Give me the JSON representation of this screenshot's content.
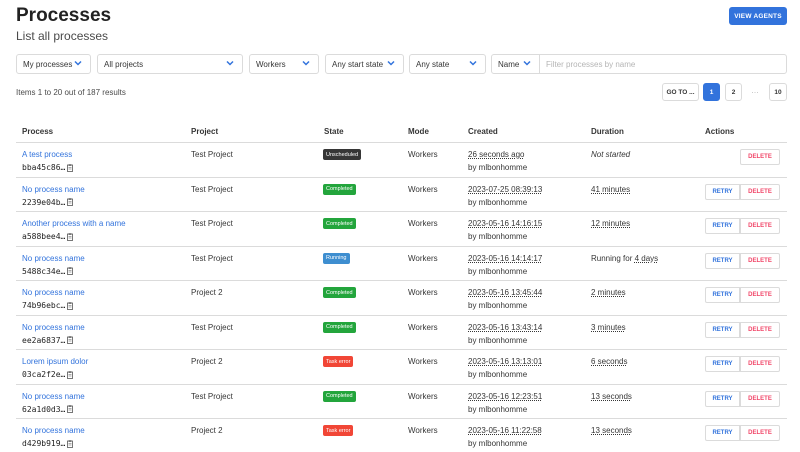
{
  "header": {
    "title": "Processes",
    "subtitle": "List all processes",
    "view_agents_label": "VIEW AGENTS"
  },
  "filters": {
    "my_processes": "My processes",
    "all_projects": "All projects",
    "mode": "Workers",
    "start_state": "Any start state",
    "state": "Any state",
    "name_field": "Name",
    "name_placeholder": "Filter processes by name"
  },
  "results": {
    "summary": "Items 1 to 20 out of 187 results"
  },
  "pagination": {
    "goto_label": "GO TO ...",
    "pages": [
      "1",
      "2",
      "10"
    ],
    "ellipsis": "…",
    "current": "1"
  },
  "table": {
    "columns": [
      "Process",
      "Project",
      "State",
      "Mode",
      "Created",
      "Duration",
      "Actions"
    ],
    "retry_label": "RETRY",
    "delete_label": "DELETE",
    "rows": [
      {
        "name": "A test process",
        "id": "bba45c86…",
        "project": "Test Project",
        "state": "Unscheduled",
        "mode": "Workers",
        "created": "26 seconds ago",
        "created_by": "by mlbonhomme",
        "duration": "Not started"
      },
      {
        "name": "No process name",
        "id": "2239e04b…",
        "project": "Test Project",
        "state": "Completed",
        "mode": "Workers",
        "created": "2023-07-25 08:39:13",
        "created_by": "by mlbonhomme",
        "duration": "41 minutes"
      },
      {
        "name": "Another process with a name",
        "id": "a588bee4…",
        "project": "Test Project",
        "state": "Completed",
        "mode": "Workers",
        "created": "2023-05-16 14:16:15",
        "created_by": "by mlbonhomme",
        "duration": "12 minutes"
      },
      {
        "name": "No process name",
        "id": "5488c34e…",
        "project": "Test Project",
        "state": "Running",
        "mode": "Workers",
        "created": "2023-05-16 14:14:17",
        "created_by": "by mlbonhomme",
        "duration_prefix": "Running for ",
        "duration": "4 days"
      },
      {
        "name": "No process name",
        "id": "74b96ebc…",
        "project": "Project 2",
        "state": "Completed",
        "mode": "Workers",
        "created": "2023-05-16 13:45:44",
        "created_by": "by mlbonhomme",
        "duration": "2 minutes"
      },
      {
        "name": "No process name",
        "id": "ee2a6837…",
        "project": "Test Project",
        "state": "Completed",
        "mode": "Workers",
        "created": "2023-05-16 13:43:14",
        "created_by": "by mlbonhomme",
        "duration": "3 minutes"
      },
      {
        "name": "Lorem ipsum dolor",
        "id": "03ca2f2e…",
        "project": "Project 2",
        "state": "Task error",
        "mode": "Workers",
        "created": "2023-05-16 13:13:01",
        "created_by": "by mlbonhomme",
        "duration": "6 seconds"
      },
      {
        "name": "No process name",
        "id": "62a1d0d3…",
        "project": "Test Project",
        "state": "Completed",
        "mode": "Workers",
        "created": "2023-05-16 12:23:51",
        "created_by": "by mlbonhomme",
        "duration": "13 seconds"
      },
      {
        "name": "No process name",
        "id": "d429b919…",
        "project": "Project 2",
        "state": "Task error",
        "mode": "Workers",
        "created": "2023-05-16 11:22:58",
        "created_by": "by mlbonhomme",
        "duration": "13 seconds"
      }
    ]
  },
  "colors": {
    "primary": "#3273dc",
    "link": "#3273dc",
    "danger": "#f14668",
    "state_unscheduled": "#363636",
    "state_completed": "#23a53c",
    "state_running": "#3e8ed0",
    "state_task_error": "#f14636"
  },
  "icons": {
    "dropdown": "chevron-down-icon",
    "copy": "clipboard-icon"
  }
}
